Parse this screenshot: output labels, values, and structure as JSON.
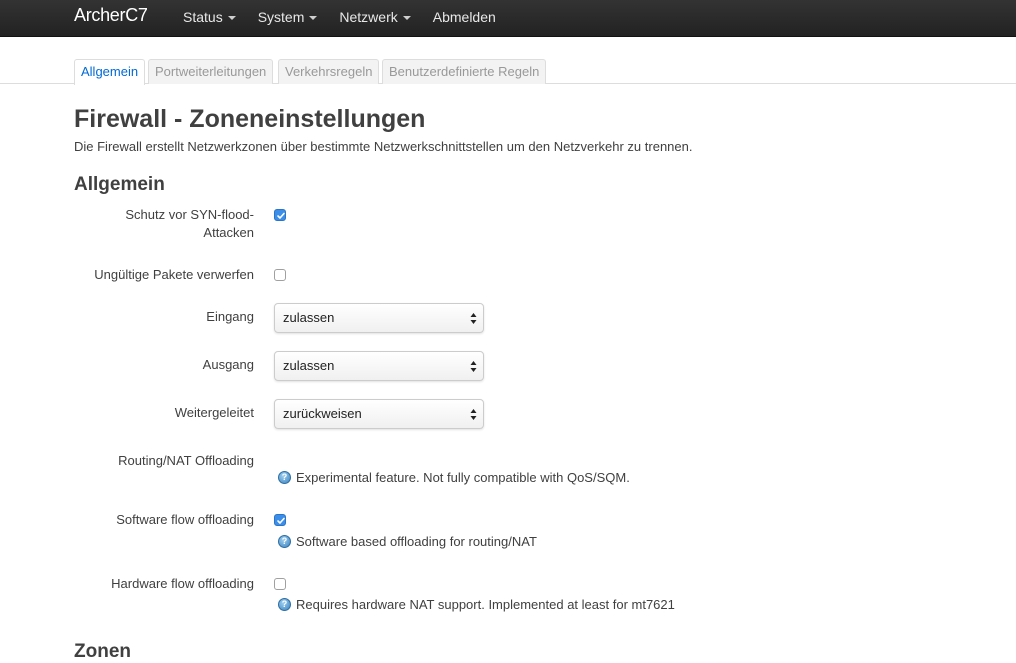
{
  "navbar": {
    "brand": "ArcherC7",
    "menu": [
      "Status",
      "System",
      "Netzwerk",
      "Abmelden"
    ]
  },
  "tabs": [
    "Allgemein",
    "Portweiterleitungen",
    "Verkehrsregeln",
    "Benutzerdefinierte Regeln"
  ],
  "active_tab": "Allgemein",
  "page": {
    "title": "Firewall - Zoneneinstellungen",
    "description": "Die Firewall erstellt Netzwerkzonen über bestimmte Netzwerkschnittstellen um den Netzverkehr zu trennen."
  },
  "general": {
    "heading": "Allgemein",
    "syn_flood": {
      "label_line1": "Schutz vor SYN-flood-",
      "label_line2": "Attacken",
      "checked": true
    },
    "invalid_packets": {
      "label": "Ungültige Pakete verwerfen",
      "checked": false
    },
    "input": {
      "label": "Eingang",
      "value": "zulassen"
    },
    "output": {
      "label": "Ausgang",
      "value": "zulassen"
    },
    "forward": {
      "label": "Weitergeleitet",
      "value": "zurückweisen"
    },
    "routing_offload": {
      "label": "Routing/NAT Offloading",
      "hint": "Experimental feature. Not fully compatible with QoS/SQM."
    },
    "software_offload": {
      "label": "Software flow offloading",
      "checked": true,
      "hint": "Software based offloading for routing/NAT"
    },
    "hardware_offload": {
      "label": "Hardware flow offloading",
      "checked": false,
      "hint": "Requires hardware NAT support. Implemented at least for mt7621"
    }
  },
  "zones": {
    "heading": "Zonen"
  },
  "icons": {
    "help": "help-icon",
    "check": "checkmark-icon",
    "dropdown": "select-arrows-icon"
  },
  "colors": {
    "navbar": "#222222",
    "active_tab": "#0069d6",
    "checkbox_checked": "#3b8eea"
  }
}
